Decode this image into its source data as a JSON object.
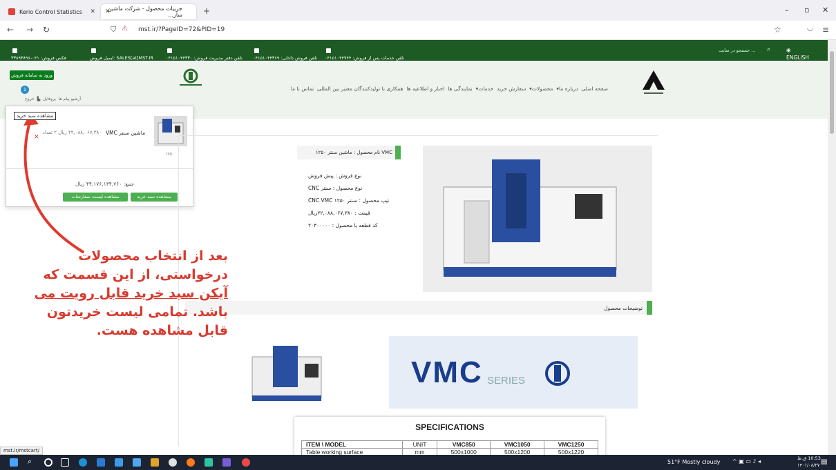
{
  "browser": {
    "tabs": [
      {
        "title": "Kerio Control Statistics"
      },
      {
        "title": "جزییات محصول - شرکت ماشین ساز..."
      }
    ],
    "new_tab": "+",
    "url": "mst.ir/?PageID=72&PID=19",
    "status_url": "mst.ir/mstcart/"
  },
  "topbar": {
    "lang": "ENGLISH",
    "search_placeholder": "جستجو در سایت ...",
    "after_sales": "تلفن خدمات پس از فروش: ۰۴۱۵۱۰۴۴۷۴۴",
    "internal_sales": "تلفن فروش داخلی: ۰۴۱۵۱۰۴۴۳۶۹",
    "management": "تلفن دفتر مدیریت فروش: ۰۴۱۵۱۰۴۴۳۳۰",
    "email": "ایمیل فروش: SALES[at]MST.IR",
    "fax": "فکس فروش: ۰۴۱-۳۳۸۹۳۸۹۶"
  },
  "header": {
    "menu": [
      "صفحه اصلی",
      "درباره ما",
      "محصولات",
      "سفارش خرید",
      "خدمات",
      "نمایندگی ها",
      "اخبار و اطلاعیه ها",
      "همکاری با تولیدکنندگان معتبر بین المللی",
      "تماس با ما"
    ],
    "login_button": "ورود به سامانه فروش",
    "user_links": [
      "آرشیو پیام ها",
      "پروفایل",
      "خروج"
    ],
    "cart_badge": "1",
    "cart_tooltip": "مشاهده سبد خرید"
  },
  "cart": {
    "item_name": "ماشین سنتر VMC",
    "item_price": "۲۲,۰۸۸,۰۶۷,۳۸۰ ریال ۲ تعداد",
    "item_code": "۱۲۵۰",
    "remove": "✕",
    "total": "جمع: ۴۴,۱۷۶,۱۳۴,۷۶۰ ریال",
    "view_cart": "مشاهده سبد خرید",
    "view_orders": "مشاهده لیست سفارشات"
  },
  "product": {
    "name_label": "نام محصول : ماشین سنتر ۱۲۵۰ VMC",
    "specs": [
      "نوع فروش : پیش فروش",
      "نوع محصول : سنتر CNC",
      "تیپ محصول : سنتر ۱۲۵۰ CNC VMC",
      "قیمت : ۲۲,۰۸۸,۰۶۷,۳۸۰ریال",
      "کد قطعه یا محصول : ۲۰۳۰۰۰۰۰"
    ],
    "desc_title": "توضیحات محصول",
    "banner_text": "VMC",
    "banner_sub": "SERIES",
    "spec_title": "SPECIFICATIONS",
    "table_headers": [
      "ITEM \\ MODEL",
      "UNIT",
      "VMC850",
      "VMC1050",
      "VMC1250"
    ],
    "table_row": [
      "Table working surface",
      "mm",
      "500x1000",
      "500x1200",
      "500x1220"
    ]
  },
  "annotation": [
    "بعد از انتخاب محصولات",
    "درخواستی، از این قسمت که",
    "آیکن سبد خرید قابل رویت می",
    "باشد. تمامی لیست خریدتون",
    "قابل مشاهده هست."
  ],
  "taskbar": {
    "weather": "51°F  Mostly cloudy",
    "time": "10:53 ق.ظ",
    "date": "۱۴۰۱/۰۸/۲۷"
  }
}
